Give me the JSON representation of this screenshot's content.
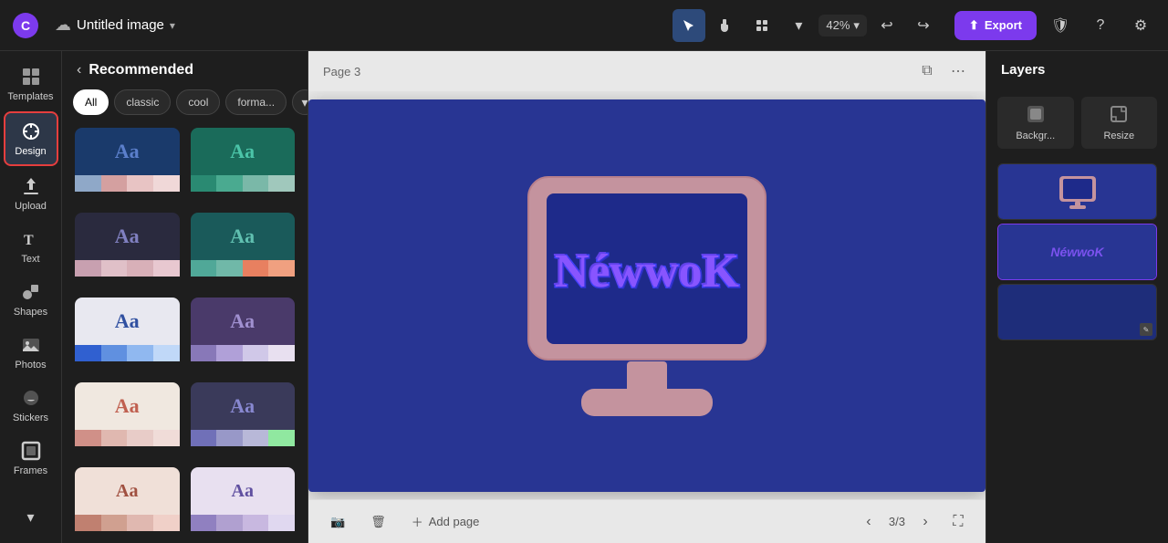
{
  "topbar": {
    "logo_label": "Canva",
    "title": "Untitled image",
    "zoom": "42%",
    "export_label": "Export"
  },
  "sidebar": {
    "items": [
      {
        "id": "templates",
        "label": "Templates",
        "icon": "grid"
      },
      {
        "id": "design",
        "label": "Design",
        "icon": "palette",
        "active": true
      },
      {
        "id": "upload",
        "label": "Upload",
        "icon": "upload"
      },
      {
        "id": "text",
        "label": "Text",
        "icon": "text"
      },
      {
        "id": "shapes",
        "label": "Shapes",
        "icon": "shapes"
      },
      {
        "id": "photos",
        "label": "Photos",
        "icon": "image"
      },
      {
        "id": "stickers",
        "label": "Stickers",
        "icon": "sticker"
      },
      {
        "id": "frames",
        "label": "Frames",
        "icon": "frame"
      }
    ]
  },
  "design_panel": {
    "title": "Recommended",
    "filters": [
      {
        "label": "All",
        "active": true
      },
      {
        "label": "classic",
        "active": false
      },
      {
        "label": "cool",
        "active": false
      },
      {
        "label": "forma...",
        "active": false
      }
    ],
    "themes": [
      {
        "id": 1,
        "class": "t1",
        "aa": "Aa"
      },
      {
        "id": 2,
        "class": "t2",
        "aa": "Aa"
      },
      {
        "id": 3,
        "class": "t3",
        "aa": "Aa"
      },
      {
        "id": 4,
        "class": "t4",
        "aa": "Aa"
      },
      {
        "id": 5,
        "class": "t5",
        "aa": "Aa"
      },
      {
        "id": 6,
        "class": "t6",
        "aa": "Aa"
      },
      {
        "id": 7,
        "class": "t7",
        "aa": "Aa"
      },
      {
        "id": 8,
        "class": "t8",
        "aa": "Aa"
      },
      {
        "id": 9,
        "class": "t9",
        "aa": "Aa"
      },
      {
        "id": 10,
        "class": "t10",
        "aa": "Aa"
      }
    ]
  },
  "canvas": {
    "page_label": "Page 3",
    "add_page_label": "Add page",
    "page_indicator": "3/3"
  },
  "right_panel": {
    "title": "Layers",
    "tools": [
      {
        "label": "Backgr...",
        "id": "background"
      },
      {
        "label": "Resize",
        "id": "resize"
      }
    ]
  }
}
